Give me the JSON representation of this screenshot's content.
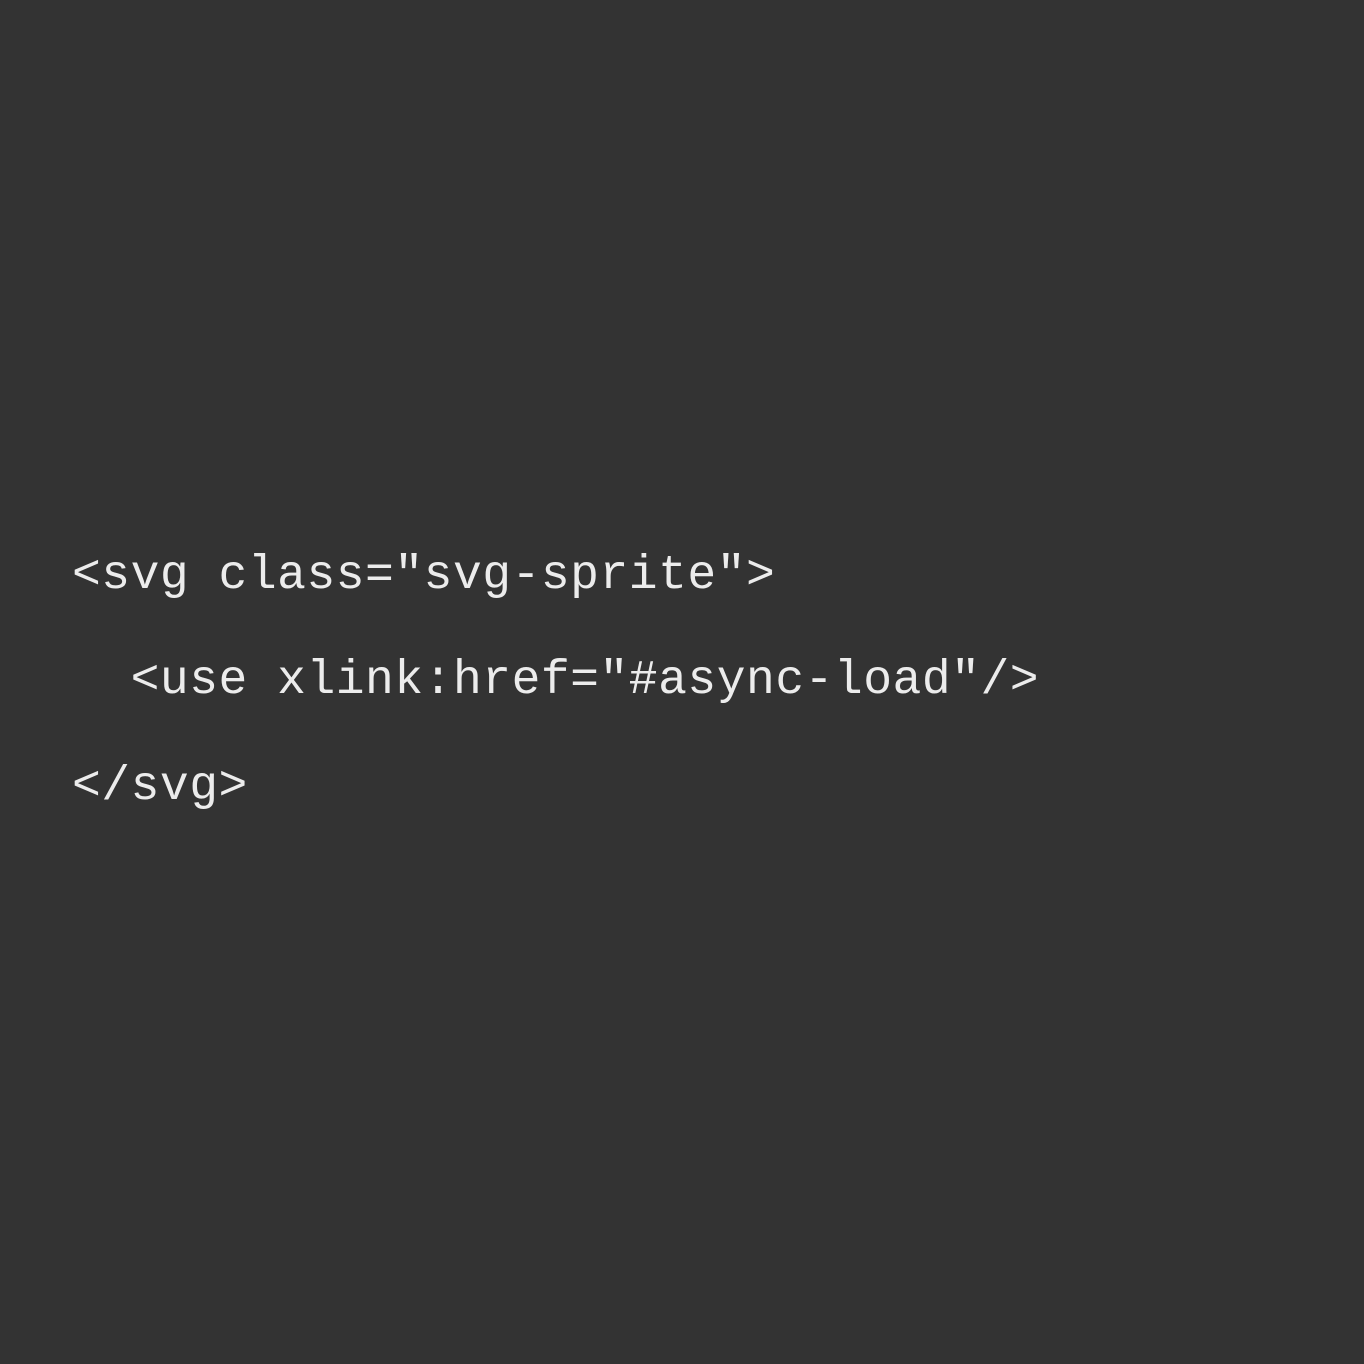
{
  "code": {
    "line1": "<svg class=\"svg-sprite\">",
    "line2": "  <use xlink:href=\"#async-load\"/>",
    "line3": "</svg>"
  },
  "colors": {
    "background": "#333333",
    "text": "#ececec"
  }
}
